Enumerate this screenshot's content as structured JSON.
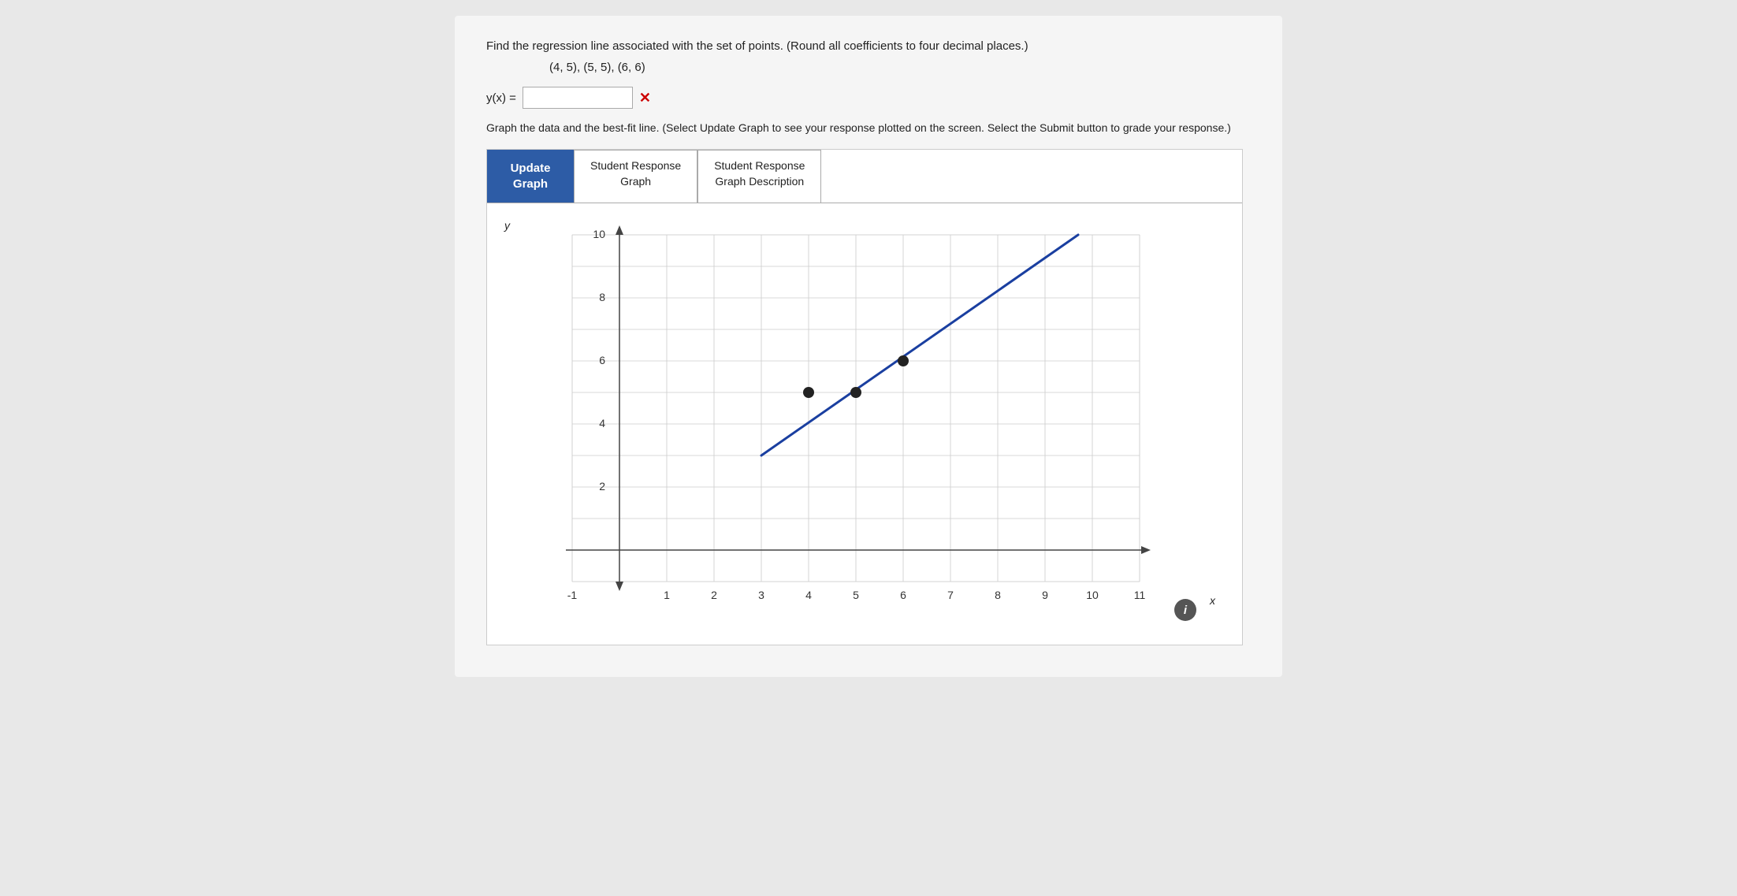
{
  "problem": {
    "instruction": "Find the regression line associated with the set of points. (Round all coefficients to four decimal places.)",
    "points": "(4, 5), (5, 5), (6, 6)",
    "equation_label": "y(x) =",
    "equation_value": "",
    "equation_placeholder": "",
    "error_symbol": "✕",
    "graph_instruction": "Graph the data and the best-fit line. (Select Update Graph to see your response plotted on the screen. Select the Submit button to grade your response.)"
  },
  "tabs": {
    "update_graph_label": "Update\nGraph",
    "tab1_label": "Student Response\nGraph",
    "tab2_label": "Student Response\nGraph Description"
  },
  "chart": {
    "x_label": "x",
    "y_label": "y",
    "x_min": -1,
    "x_max": 11,
    "y_min": -1,
    "y_max": 11,
    "x_ticks": [
      -1,
      1,
      2,
      3,
      4,
      5,
      6,
      7,
      8,
      9,
      10,
      11
    ],
    "y_ticks": [
      2,
      4,
      6,
      8,
      10
    ],
    "data_points": [
      {
        "x": 4,
        "y": 5
      },
      {
        "x": 5,
        "y": 5
      },
      {
        "x": 6,
        "y": 6
      }
    ],
    "regression_line": {
      "x1": 3.2,
      "y1": 3.2,
      "x2": 9.5,
      "y2": 10.5
    }
  },
  "info_icon_label": "i"
}
